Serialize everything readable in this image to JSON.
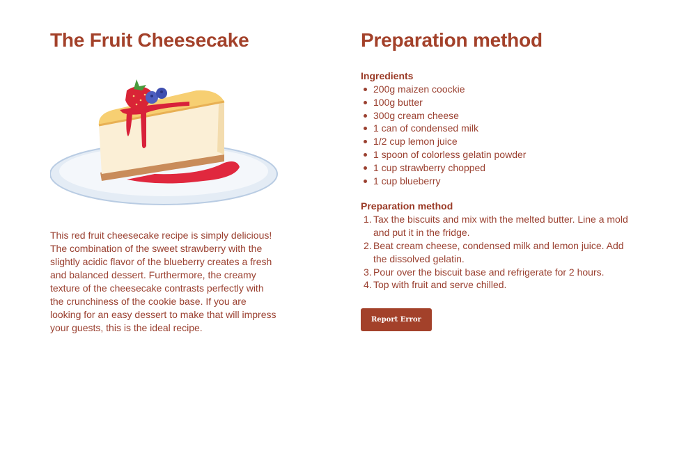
{
  "left": {
    "title": "The Fruit Cheesecake",
    "image_icon": "cheesecake-slice-illustration",
    "description": "This red fruit cheesecake recipe is simply delicious! The combination of the sweet strawberry with the slightly acidic flavor of the blueberry creates a fresh and balanced dessert. Furthermore, the creamy texture of the cheesecake contrasts perfectly with the crunchiness of the cookie base. If you are looking for an easy dessert to make that will impress your guests, this is the ideal recipe."
  },
  "right": {
    "title": "Preparation method",
    "ingredients_title": "Ingredients",
    "ingredients": [
      "200g maizen coockie",
      "100g butter",
      "300g cream cheese",
      "1 can of condensed milk",
      "1/2 cup lemon juice",
      "1 spoon of colorless gelatin powder",
      "1 cup strawberry chopped",
      "1 cup blueberry"
    ],
    "prep_title": "Preparation method",
    "steps": [
      {
        "num": "1.",
        "text": "Tax the biscuits and mix with the melted butter. Line a mold and put it in the fridge."
      },
      {
        "num": "2.",
        "text": "Beat cream cheese, condensed milk and lemon juice. Add the dissolved gelatin."
      },
      {
        "num": "3.",
        "text": "Pour over the biscuit base and refrigerate for 2 hours."
      },
      {
        "num": "4.",
        "text": "Top with fruit and serve chilled."
      }
    ],
    "report_button": "Report Error"
  },
  "colors": {
    "accent": "#a3412a",
    "text": "#9a4030",
    "background": "#ffffff"
  }
}
